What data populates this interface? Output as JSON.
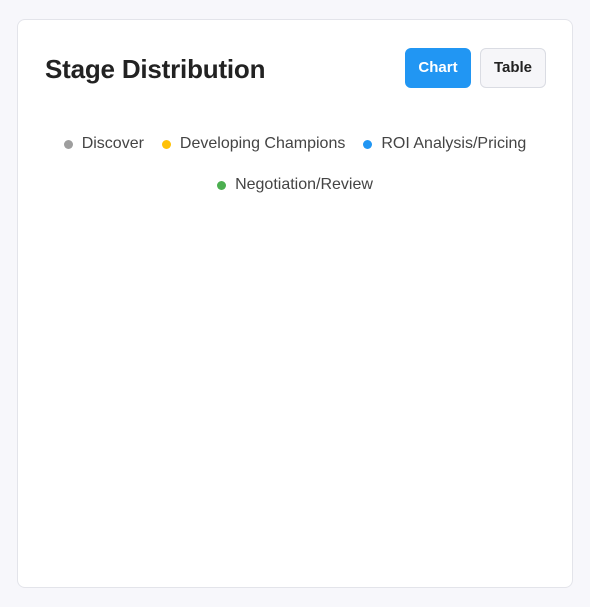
{
  "card": {
    "title": "Stage Distribution"
  },
  "toggle": {
    "chart_label": "Chart",
    "table_label": "Table",
    "active": "chart"
  },
  "legend": {
    "items": [
      {
        "label": "Discover",
        "color": "#9e9e9e"
      },
      {
        "label": "Developing Champions",
        "color": "#ffc107"
      },
      {
        "label": "ROI Analysis/Pricing",
        "color": "#2196f3"
      },
      {
        "label": "Negotiation/Review",
        "color": "#4caf50"
      }
    ]
  },
  "colors": {
    "accent": "#2196f3"
  }
}
